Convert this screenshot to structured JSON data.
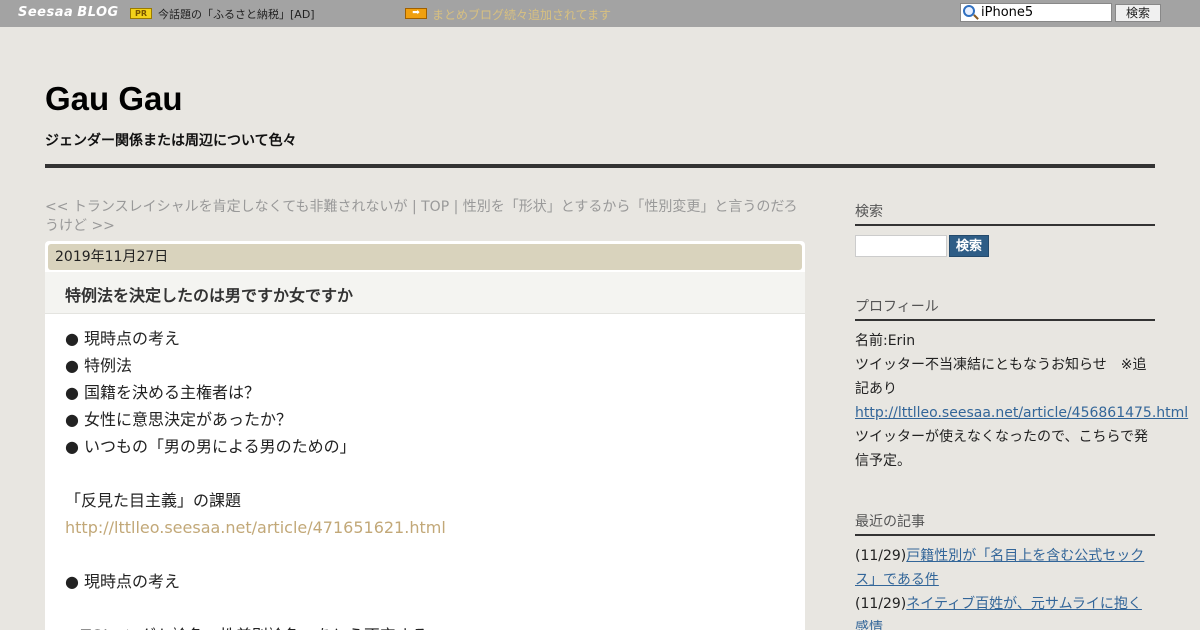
{
  "topbar": {
    "logo_seesaa": "Seesaa",
    "logo_blog": "BLOG",
    "pr_badge": "PR",
    "pr_text": "今話題の「ふるさと納税」[AD]",
    "arrow_icon": "➡",
    "notice": "まとめブログ続々追加されてます",
    "search_value": "iPhone5",
    "search_button": "検索"
  },
  "header": {
    "title": "Gau Gau",
    "description": "ジェンダー関係または周辺について色々"
  },
  "nav": {
    "text": "<< トランスレイシャルを肯定しなくても非難されないが | TOP | 性別を「形状」とするから「性別変更」と言うのだろうけど >>"
  },
  "article": {
    "date": "2019年11月27日",
    "title": "特例法を決定したのは男ですか女ですか",
    "lines": [
      "● 現時点の考え",
      "● 特例法",
      "● 国籍を決める主権者は？",
      "● 女性に意思決定があったか？",
      "● いつもの「男の男による男のための」",
      "",
      "「反見た目主義」の課題",
      "http://lttlleo.seesaa.net/article/471651621.html",
      "",
      "● 現時点の考え",
      "",
      "・TGIハングト論争、性差別論争、をとう否定する..."
    ]
  },
  "sidebar": {
    "search_heading": "検索",
    "search_button": "検索",
    "profile_heading": "プロフィール",
    "profile_name": "名前:Erin",
    "profile_text1": "ツイッター不当凍結にともなうお知らせ　※追記あり",
    "profile_link": "http://lttlleo.seesaa.net/article/456861475.html",
    "profile_text2": "ツイッターが使えなくなったので、こちらで発信予定。",
    "recent_heading": "最近の記事",
    "recent": [
      {
        "date": "(11/29)",
        "title": "戸籍性別が「名目上を含む公式セックス」である件"
      },
      {
        "date": "(11/29)",
        "title": "ネイティブ百姓が、元サムライに抱く感情"
      }
    ]
  },
  "colors": {
    "page_bg": "#e8e6e1",
    "topbar_bg": "#a3a3a3",
    "date_bar": "#d9d3bd",
    "link_blue": "#336699",
    "link_tan": "#c2a878"
  }
}
